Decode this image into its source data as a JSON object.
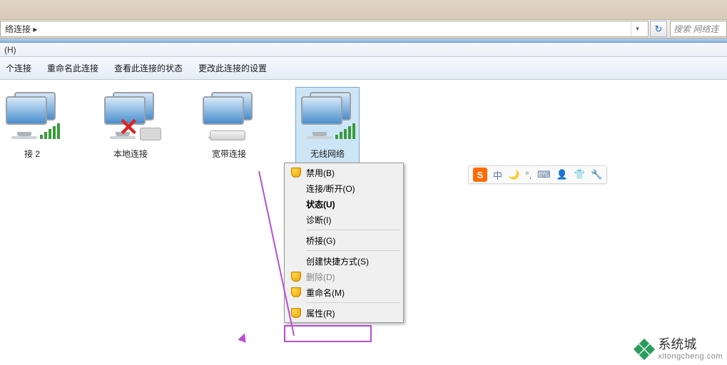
{
  "addressbar": {
    "path": "络连接 ▸",
    "dropdown_glyph": "▾",
    "refresh_glyph": "↻"
  },
  "searchbar": {
    "placeholder": "搜索 网络连"
  },
  "menubar": {
    "help": "(H)"
  },
  "toolbar": {
    "items": [
      "个连接",
      "重命名此连接",
      "查看此连接的状态",
      "更改此连接的设置"
    ]
  },
  "connections": [
    {
      "label": "接 2",
      "type": "wireless"
    },
    {
      "label": "本地连接",
      "type": "local-disabled"
    },
    {
      "label": "宽带连接",
      "type": "broadband"
    },
    {
      "label": "无线网络",
      "type": "wireless",
      "selected": true
    }
  ],
  "context_menu": {
    "items": [
      {
        "label": "禁用(B)",
        "shield": true
      },
      {
        "label": "连接/断开(O)"
      },
      {
        "label": "状态(U)",
        "bold": true
      },
      {
        "label": "诊断(I)"
      },
      {
        "sep": true
      },
      {
        "label": "桥接(G)"
      },
      {
        "sep": true
      },
      {
        "label": "创建快捷方式(S)"
      },
      {
        "label": "删除(D)",
        "disabled": true,
        "shield": true
      },
      {
        "label": "重命名(M)",
        "shield": true
      },
      {
        "sep": true
      },
      {
        "label": "属性(R)",
        "shield": true
      }
    ]
  },
  "ime": {
    "logo": "S",
    "items": [
      "中",
      "🌙",
      "°,",
      "⌨",
      "👤",
      "👕",
      "🔧"
    ]
  },
  "watermark": {
    "title": "系统城",
    "url": "xitongcheng.com"
  }
}
